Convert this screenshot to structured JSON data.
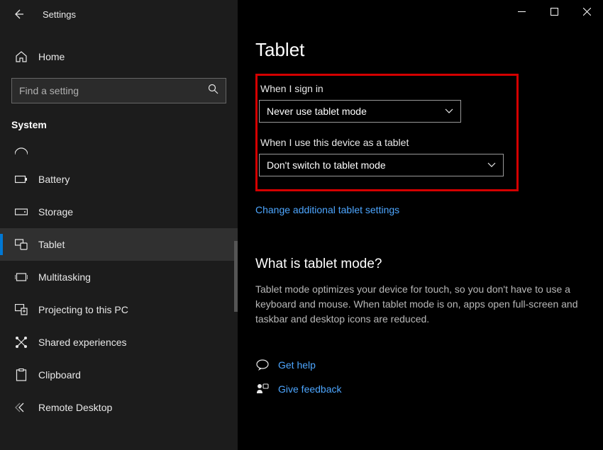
{
  "titlebar": {
    "app_name": "Settings"
  },
  "sidebar": {
    "home_label": "Home",
    "search_placeholder": "Find a setting",
    "section_label": "System",
    "items": [
      {
        "label": "Battery"
      },
      {
        "label": "Storage"
      },
      {
        "label": "Tablet"
      },
      {
        "label": "Multitasking"
      },
      {
        "label": "Projecting to this PC"
      },
      {
        "label": "Shared experiences"
      },
      {
        "label": "Clipboard"
      },
      {
        "label": "Remote Desktop"
      }
    ]
  },
  "main": {
    "page_title": "Tablet",
    "sign_in_label": "When I sign in",
    "sign_in_value": "Never use tablet mode",
    "device_tablet_label": "When I use this device as a tablet",
    "device_tablet_value": "Don't switch to tablet mode",
    "additional_link": "Change additional tablet settings",
    "what_is_title": "What is tablet mode?",
    "what_is_desc": "Tablet mode optimizes your device for touch, so you don't have to use a keyboard and mouse. When tablet mode is on, apps open full-screen and taskbar and desktop icons are reduced.",
    "get_help": "Get help",
    "give_feedback": "Give feedback"
  }
}
